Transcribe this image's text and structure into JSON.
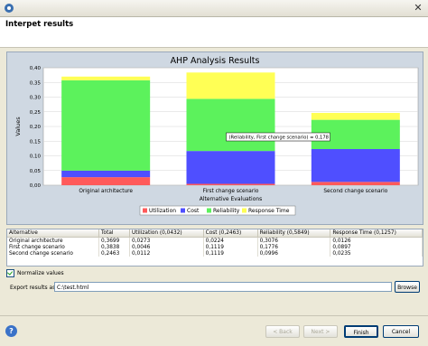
{
  "window": {
    "title": ""
  },
  "header": {
    "title": "Interpet results"
  },
  "chart_data": {
    "type": "bar",
    "stacked": true,
    "title": "AHP Analysis Results",
    "xlabel": "Alternative Evaluations",
    "ylabel": "Values",
    "ylim": [
      0,
      0.4
    ],
    "yticks": [
      "0,00",
      "0,05",
      "0,10",
      "0,15",
      "0,20",
      "0,25",
      "0,30",
      "0,35",
      "0,40"
    ],
    "categories": [
      "Original architecture",
      "First change scenario",
      "Second change scenario"
    ],
    "series": [
      {
        "name": "Utilization",
        "color": "#ff5a5a",
        "values": [
          0.0273,
          0.0046,
          0.0112
        ]
      },
      {
        "name": "Cost",
        "color": "#4f4fff",
        "values": [
          0.0224,
          0.1119,
          0.1119
        ]
      },
      {
        "name": "Reliability",
        "color": "#5cf25c",
        "values": [
          0.3076,
          0.1776,
          0.0996
        ]
      },
      {
        "name": "Response Time",
        "color": "#ffff55",
        "values": [
          0.0126,
          0.0897,
          0.0235
        ]
      }
    ],
    "tooltip": "(Reliability, First change scenario) = 0,178",
    "legend_position": "bottom"
  },
  "table": {
    "columns": [
      "Alternative",
      "Total",
      "Utilization (0,0432)",
      "Cost (0,2463)",
      "Reliability (0,5849)",
      "Response Time (0,1257)"
    ],
    "rows": [
      [
        "Original architecture",
        "0,3699",
        "0,0273",
        "0,0224",
        "0,3076",
        "0,0126"
      ],
      [
        "First change scenario",
        "0,3838",
        "0,0046",
        "0,1119",
        "0,1776",
        "0,0897"
      ],
      [
        "Second change scenario",
        "0,2463",
        "0,0112",
        "0,1119",
        "0,0996",
        "0,0235"
      ]
    ]
  },
  "normalize": {
    "label": "Normalize values",
    "checked": true
  },
  "export": {
    "label": "Export results as:",
    "value": "C:\\test.html",
    "browse_label": "Browse"
  },
  "buttons": {
    "back": "< Back",
    "next": "Next >",
    "finish": "Finish",
    "cancel": "Cancel"
  }
}
